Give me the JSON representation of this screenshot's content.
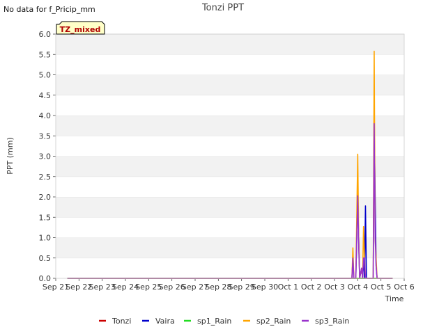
{
  "note": "No data for f_Pricip_mm",
  "badge": "TZ_mixed",
  "chart_data": {
    "type": "line",
    "title": "Tonzi PPT",
    "xlabel": "Time",
    "ylabel": "PPT (mm)",
    "x_ticks": [
      "Sep 21",
      "Sep 22",
      "Sep 23",
      "Sep 24",
      "Sep 25",
      "Sep 26",
      "Sep 27",
      "Sep 28",
      "Sep 29",
      "Sep 30",
      "Oct 1",
      "Oct 2",
      "Oct 3",
      "Oct 4",
      "Oct 5",
      "Oct 6"
    ],
    "xlim": [
      "2019-09-21",
      "2019-10-06"
    ],
    "ylim": [
      0,
      6.0
    ],
    "y_ticks": [
      0.0,
      0.5,
      1.0,
      1.5,
      2.0,
      2.5,
      3.0,
      3.5,
      4.0,
      4.5,
      5.0,
      5.5,
      6.0
    ],
    "grid": "horizontal bands",
    "legend_position": "bottom",
    "series": [
      {
        "name": "Tonzi",
        "color": "#cc0000",
        "points": [
          [
            "2019-09-21 12:00",
            0
          ],
          [
            "2019-10-05 12:00",
            0
          ]
        ]
      },
      {
        "name": "Vaira",
        "color": "#0000cc",
        "points": [
          [
            "2019-09-21 12:00",
            0
          ],
          [
            "2019-10-03 18:00",
            0
          ],
          [
            "2019-10-03 19:00",
            0.5
          ],
          [
            "2019-10-03 20:00",
            0
          ],
          [
            "2019-10-03 22:00",
            0
          ],
          [
            "2019-10-04 00:00",
            2.0
          ],
          [
            "2019-10-04 02:00",
            0
          ],
          [
            "2019-10-04 04:00",
            0.25
          ],
          [
            "2019-10-04 05:00",
            0
          ],
          [
            "2019-10-04 06:00",
            0.5
          ],
          [
            "2019-10-04 07:00",
            0
          ],
          [
            "2019-10-04 08:00",
            1.78
          ],
          [
            "2019-10-04 09:00",
            0
          ],
          [
            "2019-10-04 16:00",
            0
          ],
          [
            "2019-10-04 17:00",
            3.8
          ],
          [
            "2019-10-04 19:00",
            0.3
          ],
          [
            "2019-10-04 20:00",
            0
          ],
          [
            "2019-10-05 12:00",
            0
          ]
        ]
      },
      {
        "name": "sp1_Rain",
        "color": "#22dd22",
        "points": [
          [
            "2019-09-21 12:00",
            0
          ],
          [
            "2019-10-05 12:00",
            0
          ]
        ]
      },
      {
        "name": "sp2_Rain",
        "color": "#ffa500",
        "points": [
          [
            "2019-09-21 12:00",
            0
          ],
          [
            "2019-10-03 18:00",
            0
          ],
          [
            "2019-10-03 19:00",
            0.75
          ],
          [
            "2019-10-03 20:00",
            0
          ],
          [
            "2019-10-03 22:00",
            0
          ],
          [
            "2019-10-04 00:00",
            3.05
          ],
          [
            "2019-10-04 01:00",
            1.0
          ],
          [
            "2019-10-04 02:00",
            0
          ],
          [
            "2019-10-04 04:00",
            0.25
          ],
          [
            "2019-10-04 05:00",
            0
          ],
          [
            "2019-10-04 06:00",
            1.27
          ],
          [
            "2019-10-04 07:00",
            0.5
          ],
          [
            "2019-10-04 08:00",
            0
          ],
          [
            "2019-10-04 16:00",
            0
          ],
          [
            "2019-10-04 17:00",
            5.58
          ],
          [
            "2019-10-04 18:00",
            1.0
          ],
          [
            "2019-10-04 19:00",
            0.5
          ],
          [
            "2019-10-04 20:00",
            0
          ],
          [
            "2019-10-05 12:00",
            0
          ]
        ]
      },
      {
        "name": "sp3_Rain",
        "color": "#9933cc",
        "points": [
          [
            "2019-09-21 12:00",
            0
          ],
          [
            "2019-10-03 18:00",
            0
          ],
          [
            "2019-10-03 19:00",
            0.5
          ],
          [
            "2019-10-03 20:00",
            0
          ],
          [
            "2019-10-03 22:00",
            0
          ],
          [
            "2019-10-04 00:00",
            2.03
          ],
          [
            "2019-10-04 01:00",
            0.8
          ],
          [
            "2019-10-04 02:00",
            0
          ],
          [
            "2019-10-04 04:00",
            0.25
          ],
          [
            "2019-10-04 05:00",
            0
          ],
          [
            "2019-10-04 06:00",
            0.5
          ],
          [
            "2019-10-04 07:00",
            0.5
          ],
          [
            "2019-10-04 08:00",
            0
          ],
          [
            "2019-10-04 16:00",
            0
          ],
          [
            "2019-10-04 17:00",
            3.8
          ],
          [
            "2019-10-04 18:00",
            1.0
          ],
          [
            "2019-10-04 19:00",
            0.3
          ],
          [
            "2019-10-04 20:00",
            0
          ],
          [
            "2019-10-05 12:00",
            0
          ]
        ]
      }
    ]
  }
}
